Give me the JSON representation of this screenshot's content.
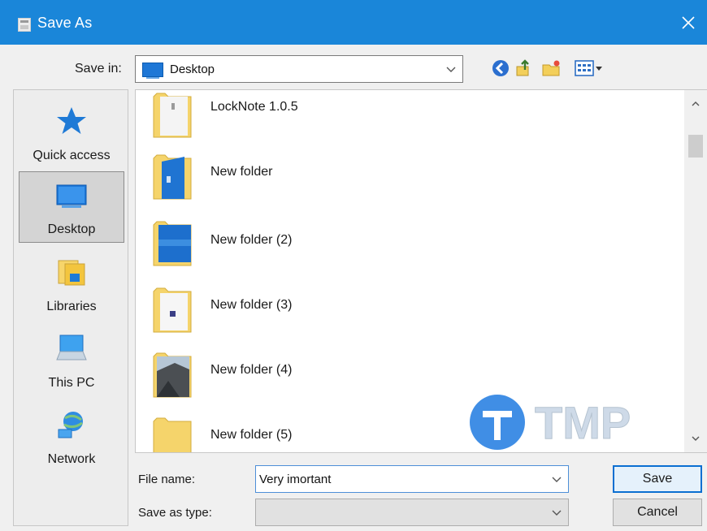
{
  "window": {
    "title": "Save As"
  },
  "toolbar": {
    "save_in_label": "Save in:",
    "save_in_value": "Desktop"
  },
  "places": [
    {
      "label": "Quick access",
      "icon": "star-icon"
    },
    {
      "label": "Desktop",
      "icon": "desktop-icon",
      "selected": true
    },
    {
      "label": "Libraries",
      "icon": "libraries-icon"
    },
    {
      "label": "This PC",
      "icon": "computer-icon"
    },
    {
      "label": "Network",
      "icon": "network-icon"
    }
  ],
  "files": [
    {
      "name": "LockNote 1.0.5"
    },
    {
      "name": "New folder"
    },
    {
      "name": "New folder (2)"
    },
    {
      "name": "New folder (3)"
    },
    {
      "name": "New folder (4)"
    },
    {
      "name": "New folder (5)"
    }
  ],
  "form": {
    "file_name_label": "File name:",
    "file_name_value": "Very imortant",
    "save_as_type_label": "Save as type:",
    "save_as_type_value": ""
  },
  "buttons": {
    "save": "Save",
    "cancel": "Cancel"
  },
  "watermark": {
    "text": "TMP"
  },
  "colors": {
    "titlebar": "#1a86d9",
    "accent": "#0b6fd1",
    "folder": "#f5d46b"
  }
}
